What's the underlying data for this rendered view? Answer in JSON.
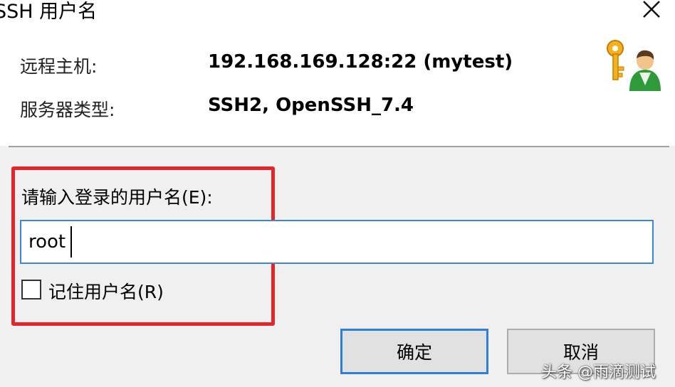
{
  "dialog": {
    "title": "SSH 用户名",
    "close_icon": "close-icon"
  },
  "info": {
    "remote_host_label": "远程主机:",
    "remote_host_value": "192.168.169.128:22 (mytest)",
    "server_type_label": "服务器类型:",
    "server_type_value": "SSH2, OpenSSH_7.4",
    "icon": "key-user-icon"
  },
  "form": {
    "prompt": "请输入登录的用户名(E):",
    "username_value": "root",
    "remember_label": "记住用户名(R)",
    "remember_checked": false
  },
  "buttons": {
    "ok": "确定",
    "cancel": "取消"
  },
  "watermark": "头条 @雨滴测试",
  "colors": {
    "highlight": "#e4262b",
    "focus_border": "#3c86d6",
    "background": "#f0f0f0"
  }
}
